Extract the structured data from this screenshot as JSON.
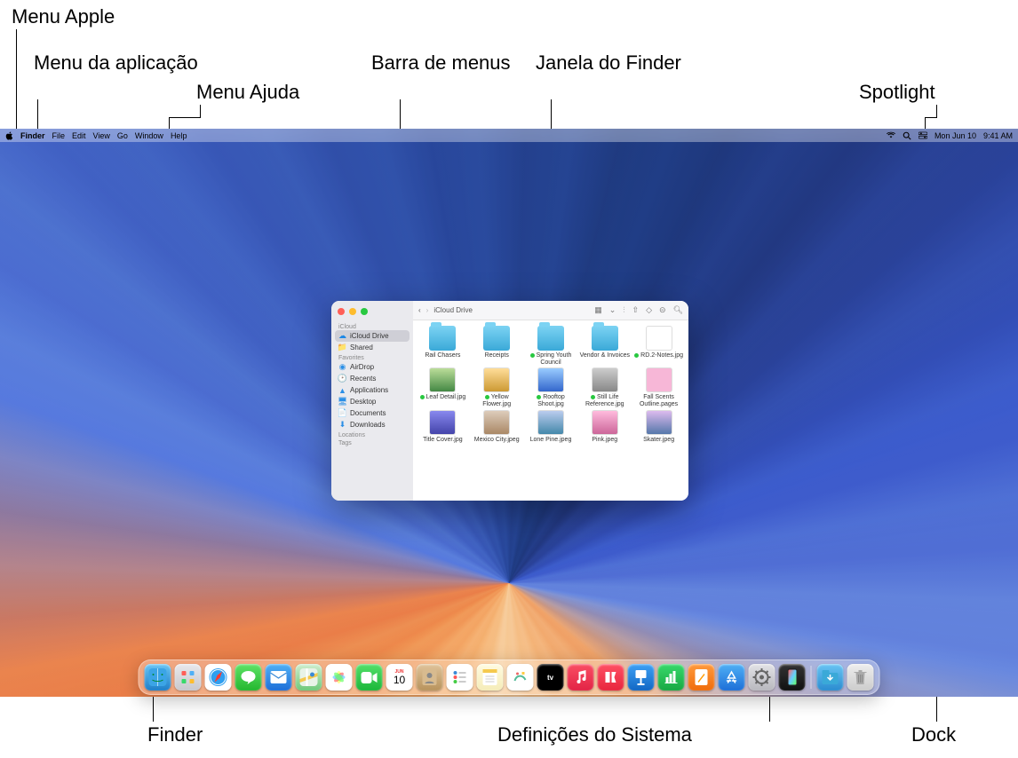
{
  "callouts": {
    "apple_menu": "Menu Apple",
    "app_menu": "Menu da aplicação",
    "help_menu": "Menu Ajuda",
    "menubar": "Barra de menus",
    "finder_window": "Janela do Finder",
    "spotlight": "Spotlight",
    "finder": "Finder",
    "system_settings": "Definições do Sistema",
    "dock": "Dock"
  },
  "menubar": {
    "app": "Finder",
    "items": [
      "File",
      "Edit",
      "View",
      "Go",
      "Window",
      "Help"
    ],
    "date": "Mon Jun 10",
    "time": "9:41 AM"
  },
  "finder": {
    "title": "iCloud Drive",
    "sidebar": {
      "sections": [
        {
          "title": "iCloud",
          "items": [
            {
              "label": "iCloud Drive",
              "icon": "cloud",
              "color": "#1e88e5",
              "selected": true
            },
            {
              "label": "Shared",
              "icon": "folder-shared",
              "color": "#1e88e5"
            }
          ]
        },
        {
          "title": "Favorites",
          "items": [
            {
              "label": "AirDrop",
              "icon": "airdrop",
              "color": "#2b8fe6"
            },
            {
              "label": "Recents",
              "icon": "clock",
              "color": "#2b8fe6"
            },
            {
              "label": "Applications",
              "icon": "apps",
              "color": "#2b8fe6"
            },
            {
              "label": "Desktop",
              "icon": "desktop",
              "color": "#2b8fe6"
            },
            {
              "label": "Documents",
              "icon": "doc",
              "color": "#2b8fe6"
            },
            {
              "label": "Downloads",
              "icon": "download",
              "color": "#2b8fe6"
            }
          ]
        },
        {
          "title": "Locations",
          "items": []
        },
        {
          "title": "Tags",
          "items": []
        }
      ]
    },
    "files": [
      {
        "name": "Rail Chasers",
        "type": "folder"
      },
      {
        "name": "Receipts",
        "type": "folder"
      },
      {
        "name": "Spring Youth Council",
        "type": "folder",
        "synced": true
      },
      {
        "name": "Vendor & Invoices",
        "type": "folder"
      },
      {
        "name": "RD.2-Notes.jpg",
        "type": "image",
        "thumb": "l",
        "synced": true
      },
      {
        "name": "Leaf Detail.jpg",
        "type": "image",
        "thumb": "b",
        "synced": true
      },
      {
        "name": "Yellow Flower.jpg",
        "type": "image",
        "thumb": "c",
        "synced": true
      },
      {
        "name": "Rooftop Shoot.jpg",
        "type": "image",
        "thumb": "d",
        "synced": true
      },
      {
        "name": "Still Life Reference.jpg",
        "type": "image",
        "thumb": "e",
        "synced": true
      },
      {
        "name": "Fall Scents Outline.pages",
        "type": "image",
        "thumb": "f"
      },
      {
        "name": "Title Cover.jpg",
        "type": "image",
        "thumb": "g"
      },
      {
        "name": "Mexico City.jpeg",
        "type": "image",
        "thumb": "h"
      },
      {
        "name": "Lone Pine.jpeg",
        "type": "image",
        "thumb": "i"
      },
      {
        "name": "Pink.jpeg",
        "type": "image",
        "thumb": "j"
      },
      {
        "name": "Skater.jpeg",
        "type": "image",
        "thumb": "k"
      }
    ]
  },
  "calendar_day": "10",
  "calendar_month": "JUN",
  "dock_apps": [
    "Finder",
    "Launchpad",
    "Safari",
    "Messages",
    "Mail",
    "Maps",
    "Photos",
    "FaceTime",
    "Calendar",
    "Contacts",
    "Reminders",
    "Notes",
    "Freeform",
    "TV",
    "Music",
    "News",
    "Keynote",
    "Numbers",
    "Pages",
    "App Store",
    "System Settings",
    "iPhone Mirroring"
  ],
  "dock_right": [
    "Downloads",
    "Trash"
  ]
}
